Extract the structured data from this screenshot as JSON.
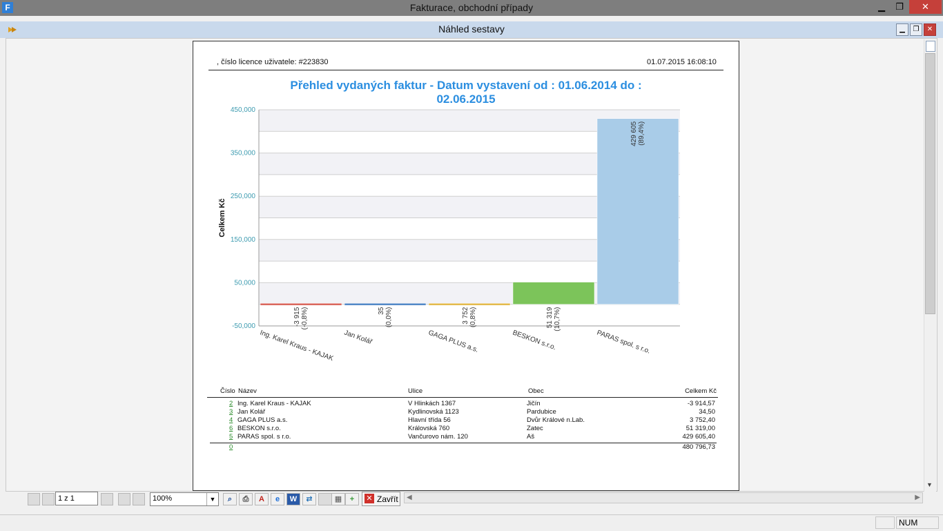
{
  "app": {
    "title": "Fakturace, obchodní případy",
    "icon_letter": "F"
  },
  "window": {
    "title": "Náhled sestavy"
  },
  "report": {
    "license_text": ",  číslo licence uživatele: #223830",
    "datetime": "01.07.2015 16:08:10",
    "title_line1": "Přehled vydaných faktur - Datum vystavení od : 01.06.2014 do :",
    "title_line2": "02.06.2015"
  },
  "chart_data": {
    "type": "bar",
    "ylabel": "Celkem Kč",
    "ylim": [
      -50000,
      450000
    ],
    "yticks": [
      "450,000",
      "350,000",
      "250,000",
      "150,000",
      "50,000",
      "-50,000"
    ],
    "categories": [
      "Ing. Karel Kraus - KAJAK",
      "Jan Kolář",
      "GAGA PLUS a.s.",
      "BESKON s.r.o.",
      "PARAS spol. s r.o."
    ],
    "values": [
      -3914.57,
      34.5,
      3752.4,
      51319,
      429605.4
    ],
    "value_labels": [
      "-3 915",
      "35",
      "3 752",
      "51 319",
      "429 605"
    ],
    "pct_labels": [
      "(-0,8%)",
      "(0,0%)",
      "(0,8%)",
      "(10,7%)",
      "(89,4%)"
    ],
    "colors": [
      "#d9655a",
      "#4f86c6",
      "#e3b94a",
      "#7cc45a",
      "#a9cce8"
    ]
  },
  "table": {
    "headers": [
      "Číslo",
      "Název",
      "Ulice",
      "Obec",
      "Celkem Kč"
    ],
    "rows": [
      {
        "cislo": "2",
        "nazev": "Ing. Karel Kraus - KAJAK",
        "ulice": "V Hlinkách 1367",
        "obec": "Jičín",
        "celkem": "-3 914,57"
      },
      {
        "cislo": "3",
        "nazev": "Jan Kolář",
        "ulice": "Kydlinovská 1123",
        "obec": "Pardubice",
        "celkem": "34,50"
      },
      {
        "cislo": "4",
        "nazev": "GAGA PLUS a.s.",
        "ulice": "Hlavní třída 56",
        "obec": "Dvůr Králové n.Lab.",
        "celkem": "3 752,40"
      },
      {
        "cislo": "6",
        "nazev": "BESKON s.r.o.",
        "ulice": "Královská 760",
        "obec": "Zatec",
        "celkem": "51 319,00"
      },
      {
        "cislo": "5",
        "nazev": "PARAS spol. s r.o.",
        "ulice": "Vančurovo nám. 120",
        "obec": "Aš",
        "celkem": "429 605,40"
      }
    ],
    "total_count": "0",
    "total_sum": "480 796,73"
  },
  "toolbar": {
    "page_value": "1 z 1",
    "zoom_value": "100%",
    "close_label": "Zavřít",
    "close_glyph": "✕"
  },
  "statusbar": {
    "num": "NUM"
  }
}
